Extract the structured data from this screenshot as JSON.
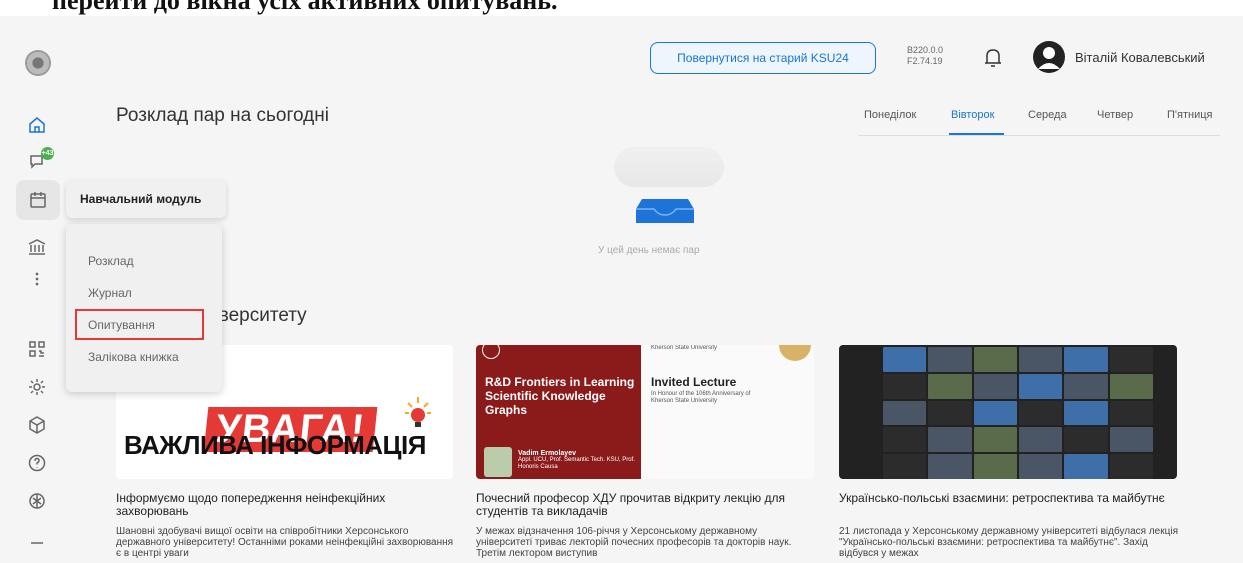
{
  "doc_caption": "перейти до вікна усіх активних опитувань.",
  "sidebar": {
    "badge_count": "+43",
    "icons": [
      "logo",
      "home-icon",
      "chat-icon",
      "calendar-icon",
      "institution-icon",
      "more-icon",
      "qr-icon",
      "settings-icon",
      "cube-icon",
      "help-icon",
      "openai-icon",
      "minus-icon"
    ]
  },
  "header": {
    "old_button": "Повернутися на старий KSU24",
    "version_line1": "B220.0.0",
    "version_line2": "F2.74.19",
    "username": "Віталій Ковалевський"
  },
  "schedule": {
    "title": "Розклад пар на сьогодні",
    "days": [
      "Понеділок",
      "Вівторок",
      "Середа",
      "Четвер",
      "П'ятниця"
    ],
    "active_day": "Вівторок",
    "empty_text": "У цей день немає пар"
  },
  "news": {
    "title_partial": "ніверситету",
    "cards": [
      {
        "heading": "Інформуємо щодо попередження неінфекційних захворювань",
        "text": "Шановні здобувачі вищої освіти на співробітники Херсонського державного університету! Останніми роками неінфекційні захворювання є в центрі уваги",
        "img_text1": "УВАГА!",
        "img_text2": "ВАЖЛИВА ІНФОРМАЦІЯ"
      },
      {
        "heading": "Почесний професор ХДУ прочитав відкриту лекцію для студентів та викладачів",
        "text": "У межах відзначення 106-річчя у Херсонському державному університеті триває лекторій почесних професорів та докторів наук. Третім лектором виступив",
        "img_left_title": "R&D Frontiers in Learning Scientific Knowledge Graphs",
        "img_left_name": "Vadim Ermolayev",
        "img_left_role": "Appl. UCU, Prof. Semantic Tech. KSU, Prof. Honoris Causa",
        "img_right_uni": "Kherson State University",
        "img_right_title": "Invited Lecture",
        "img_right_sub": "In Honour of the 106th Anniversary of Kherson State University"
      },
      {
        "heading": "Українсько-польські взаємини: ретроспектива та майбутнє",
        "text": "21 листопада у Херсонському державному університеті відбулася лекція \"Українсько-польські взаємини: ретроспектива та майбутнє\". Захід відбувся у межах"
      }
    ]
  },
  "popup": {
    "header": "Навчальний модуль",
    "items": [
      "Розклад",
      "Журнал",
      "Опитування",
      "Залікова книжка"
    ],
    "highlighted": "Опитування"
  },
  "colors": {
    "accent": "#1976d2",
    "highlight_frame": "#e53935",
    "badge": "#4caf50"
  }
}
